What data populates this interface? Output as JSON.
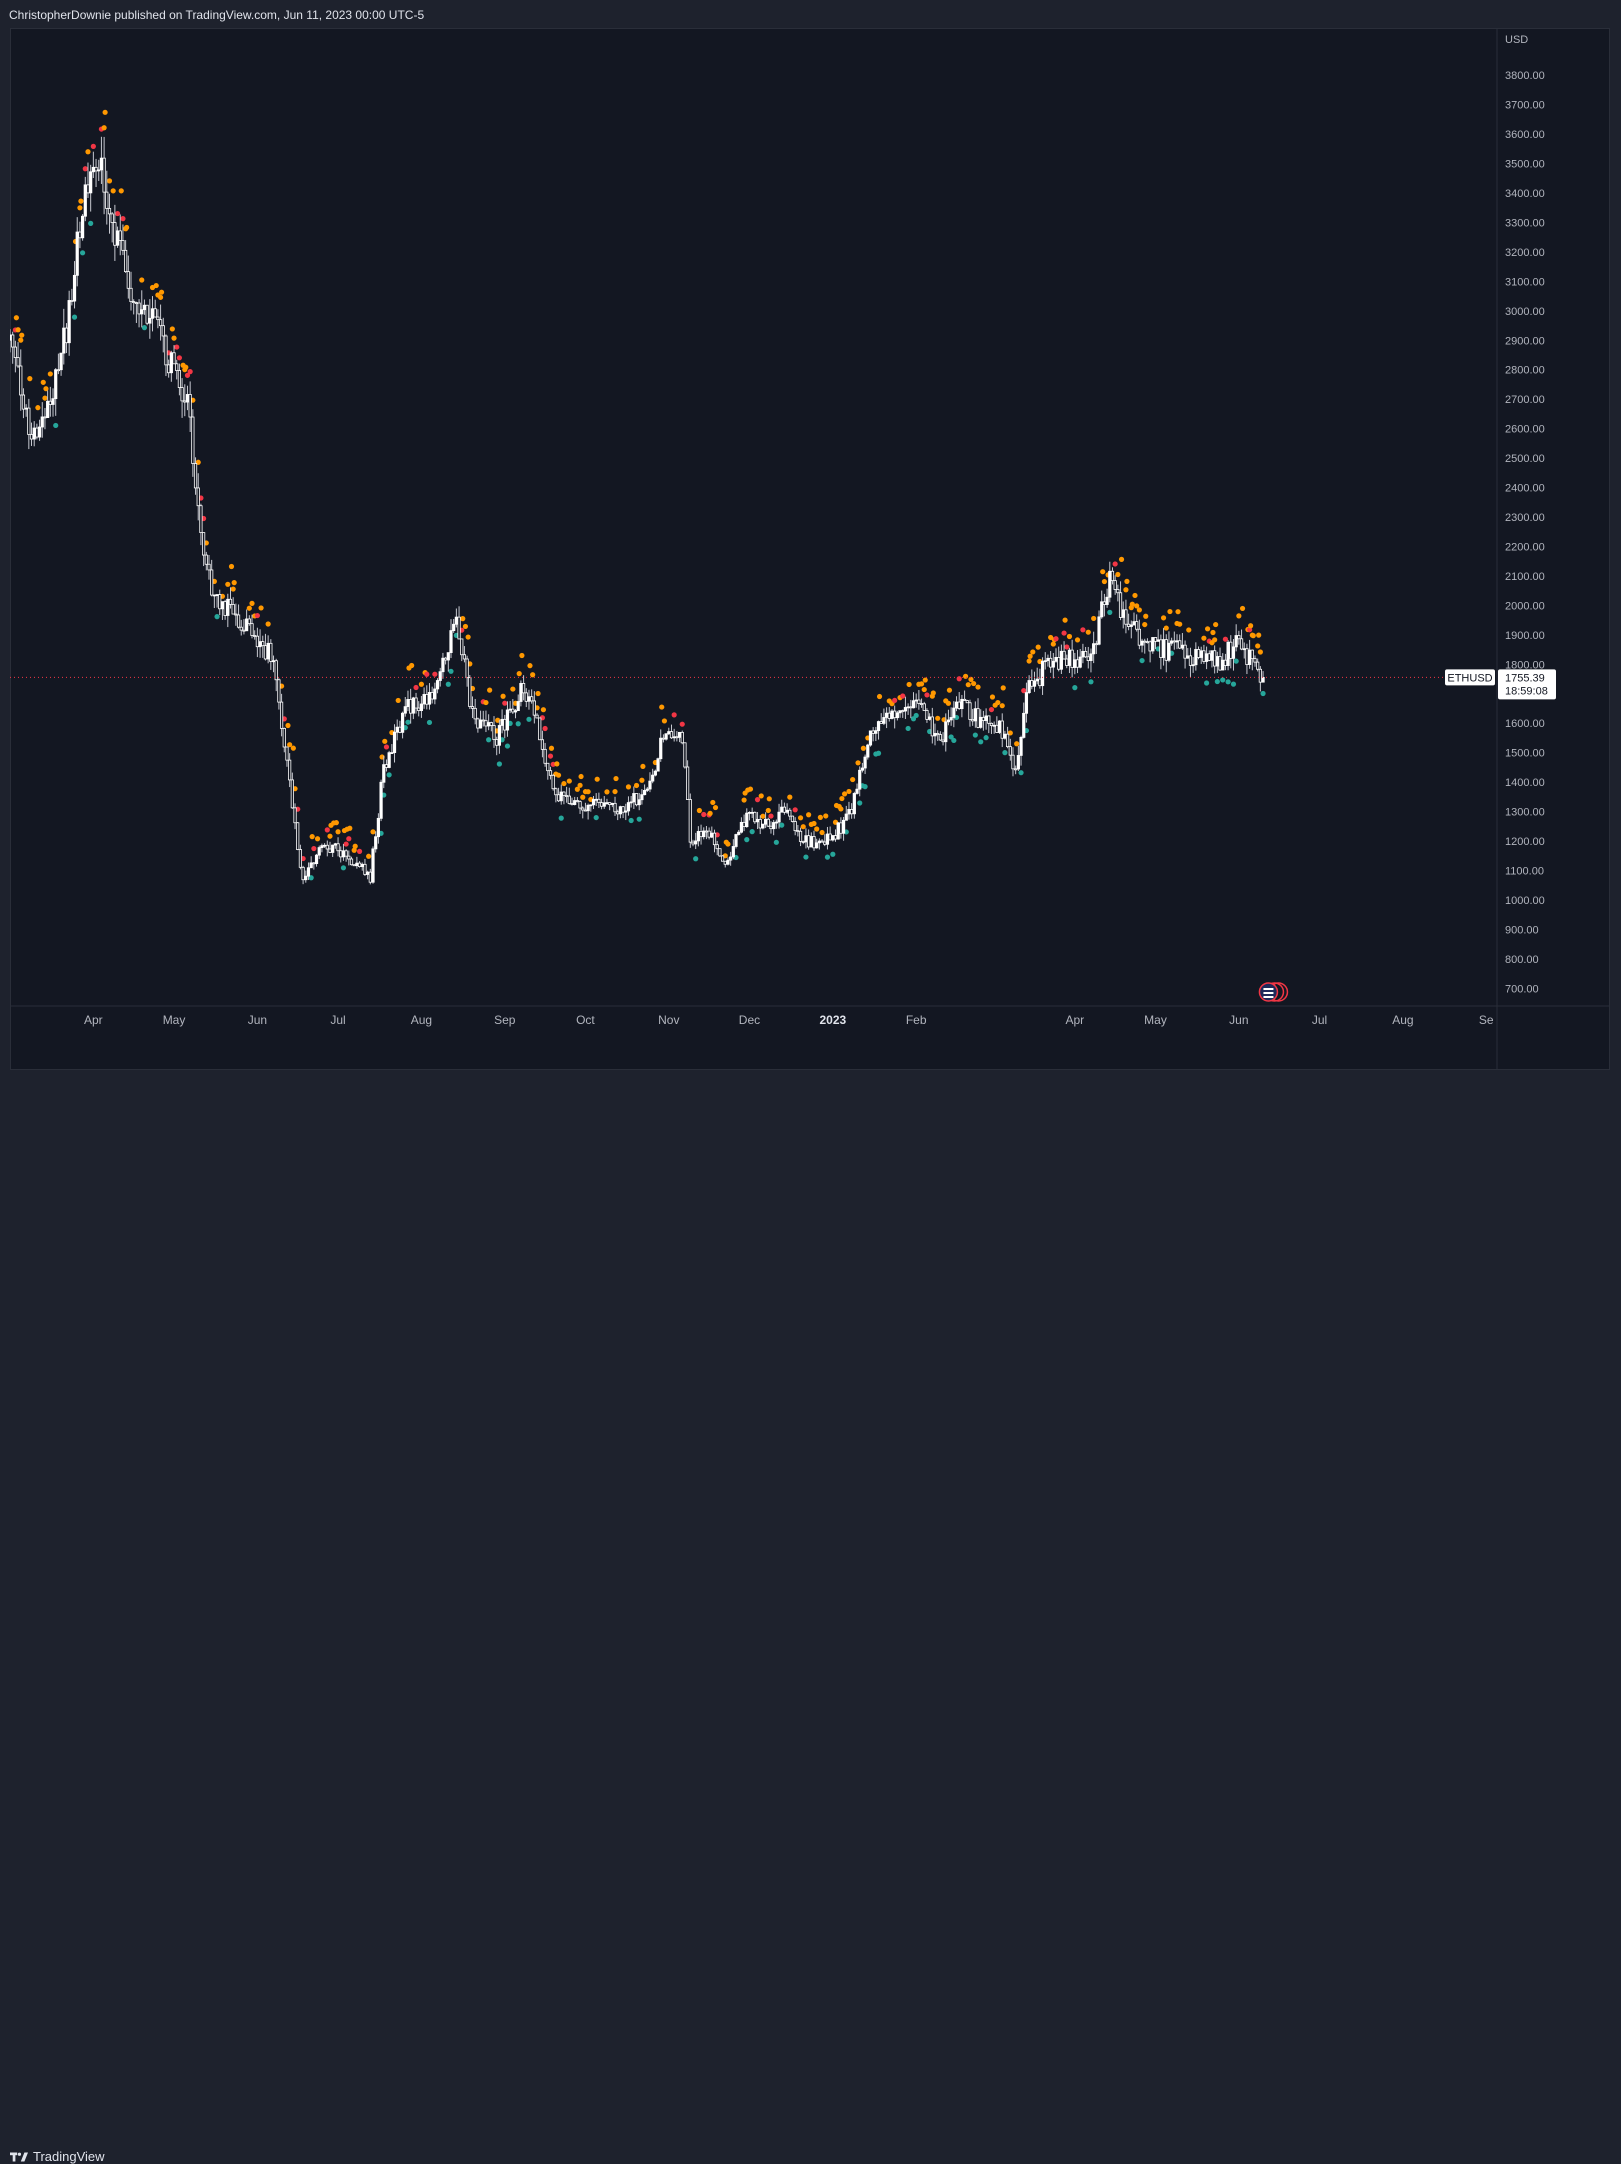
{
  "header": {
    "publish_text": "ChristopherDownie published on TradingView.com, Jun 11, 2023 00:00 UTC-5"
  },
  "footer": {
    "brand_label": "TradingView",
    "brand_logo_icon": "tradingview-logo-icon"
  },
  "colors": {
    "background": "#131722",
    "candle_up": "#ffffff",
    "candle_down": "#ffffff",
    "dot_green": "#26a69a",
    "dot_orange": "#ff9800",
    "dot_red": "#f23645",
    "price_line": "#f23645"
  },
  "chart_data": {
    "type": "candlestick",
    "symbol": "ETHUSD",
    "currency": "USD",
    "last_price": "1755.39",
    "countdown": "18:59:08",
    "y_ticks": [
      "700.00",
      "800.00",
      "900.00",
      "1000.00",
      "1100.00",
      "1200.00",
      "1300.00",
      "1400.00",
      "1500.00",
      "1600.00",
      "1700.00",
      "1800.00",
      "1900.00",
      "2000.00",
      "2100.00",
      "2200.00",
      "2300.00",
      "2400.00",
      "2500.00",
      "2600.00",
      "2700.00",
      "2800.00",
      "2900.00",
      "3000.00",
      "3100.00",
      "3200.00",
      "3300.00",
      "3400.00",
      "3500.00",
      "3600.00",
      "3700.00",
      "3800.00"
    ],
    "ylim": [
      640,
      3960
    ],
    "x_ticks": [
      {
        "label": "Apr",
        "date": "2022-04-01"
      },
      {
        "label": "May",
        "date": "2022-05-01"
      },
      {
        "label": "Jun",
        "date": "2022-06-01"
      },
      {
        "label": "Jul",
        "date": "2022-07-01"
      },
      {
        "label": "Aug",
        "date": "2022-08-01"
      },
      {
        "label": "Sep",
        "date": "2022-09-01"
      },
      {
        "label": "Oct",
        "date": "2022-10-01"
      },
      {
        "label": "Nov",
        "date": "2022-11-01"
      },
      {
        "label": "Dec",
        "date": "2022-12-01"
      },
      {
        "label": "2023",
        "date": "2023-01-01",
        "bold": true
      },
      {
        "label": "Feb",
        "date": "2023-02-01"
      },
      {
        "label": "Apr",
        "date": "2023-04-01"
      },
      {
        "label": "May",
        "date": "2023-05-01"
      },
      {
        "label": "Jun",
        "date": "2023-06-01"
      },
      {
        "label": "Jul",
        "date": "2023-07-01"
      },
      {
        "label": "Aug",
        "date": "2023-08-01"
      },
      {
        "label": "Se",
        "date": "2023-09-01"
      }
    ],
    "price_path": [
      [
        "2022-03-01",
        2900
      ],
      [
        "2022-03-08",
        2600
      ],
      [
        "2022-03-15",
        2650
      ],
      [
        "2022-03-22",
        2950
      ],
      [
        "2022-03-29",
        3400
      ],
      [
        "2022-04-03",
        3500
      ],
      [
        "2022-04-09",
        3250
      ],
      [
        "2022-04-16",
        3050
      ],
      [
        "2022-04-23",
        2950
      ],
      [
        "2022-05-01",
        2800
      ],
      [
        "2022-05-06",
        2700
      ],
      [
        "2022-05-10",
        2300
      ],
      [
        "2022-05-15",
        2050
      ],
      [
        "2022-05-22",
        1980
      ],
      [
        "2022-05-31",
        1900
      ],
      [
        "2022-06-07",
        1820
      ],
      [
        "2022-06-12",
        1450
      ],
      [
        "2022-06-18",
        1050
      ],
      [
        "2022-06-25",
        1200
      ],
      [
        "2022-07-04",
        1150
      ],
      [
        "2022-07-13",
        1080
      ],
      [
        "2022-07-18",
        1450
      ],
      [
        "2022-07-27",
        1650
      ],
      [
        "2022-08-05",
        1680
      ],
      [
        "2022-08-14",
        1950
      ],
      [
        "2022-08-20",
        1620
      ],
      [
        "2022-08-29",
        1550
      ],
      [
        "2022-09-08",
        1720
      ],
      [
        "2022-09-13",
        1600
      ],
      [
        "2022-09-20",
        1350
      ],
      [
        "2022-09-28",
        1330
      ],
      [
        "2022-10-06",
        1320
      ],
      [
        "2022-10-15",
        1300
      ],
      [
        "2022-10-25",
        1400
      ],
      [
        "2022-10-31",
        1580
      ],
      [
        "2022-11-06",
        1560
      ],
      [
        "2022-11-09",
        1200
      ],
      [
        "2022-11-15",
        1250
      ],
      [
        "2022-11-22",
        1120
      ],
      [
        "2022-11-30",
        1280
      ],
      [
        "2022-12-08",
        1260
      ],
      [
        "2022-12-14",
        1300
      ],
      [
        "2022-12-20",
        1200
      ],
      [
        "2022-12-31",
        1200
      ],
      [
        "2023-01-08",
        1300
      ],
      [
        "2023-01-14",
        1550
      ],
      [
        "2023-01-22",
        1620
      ],
      [
        "2023-02-02",
        1650
      ],
      [
        "2023-02-10",
        1540
      ],
      [
        "2023-02-16",
        1690
      ],
      [
        "2023-02-25",
        1600
      ],
      [
        "2023-03-05",
        1580
      ],
      [
        "2023-03-10",
        1430
      ],
      [
        "2023-03-14",
        1700
      ],
      [
        "2023-03-22",
        1800
      ],
      [
        "2023-04-01",
        1820
      ],
      [
        "2023-04-08",
        1850
      ],
      [
        "2023-04-14",
        2100
      ],
      [
        "2023-04-19",
        1950
      ],
      [
        "2023-04-26",
        1880
      ],
      [
        "2023-05-01",
        1850
      ],
      [
        "2023-05-08",
        1850
      ],
      [
        "2023-05-15",
        1820
      ],
      [
        "2023-05-25",
        1810
      ],
      [
        "2023-05-31",
        1870
      ],
      [
        "2023-06-05",
        1820
      ],
      [
        "2023-06-10",
        1755.39
      ]
    ],
    "grid": false,
    "legend": "none"
  }
}
